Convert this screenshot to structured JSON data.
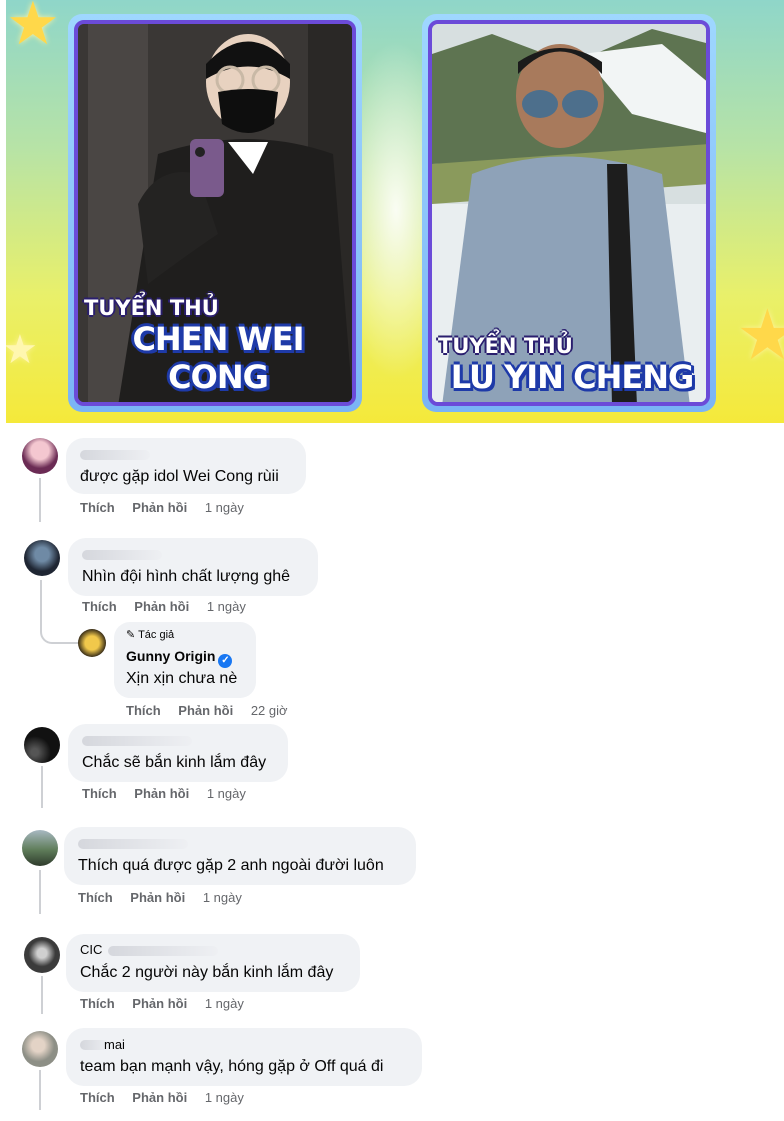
{
  "banner": {
    "card1": {
      "label_small": "TUYỂN THỦ",
      "label_big": "CHEN WEI CONG"
    },
    "card2": {
      "label_small": "TUYỂN THỦ",
      "label_big": "LU YIN CHENG"
    }
  },
  "comments": [
    {
      "name": "",
      "text": "được gặp idol Wei Cong rùii",
      "like": "Thích",
      "reply": "Phản hồi",
      "time": "1 ngày"
    },
    {
      "name": "",
      "text": "Nhìn đội hình chất lượng ghê",
      "like": "Thích",
      "reply": "Phản hồi",
      "time": "1 ngày",
      "reply_comment": {
        "tag": "Tác giả",
        "name": "Gunny Origin",
        "text": "Xịn xịn chưa nè",
        "like": "Thích",
        "reply": "Phản hồi",
        "time": "22 giờ"
      }
    },
    {
      "name": "",
      "text": "Chắc sẽ bắn kinh lắm đây",
      "like": "Thích",
      "reply": "Phản hồi",
      "time": "1 ngày"
    },
    {
      "name": "",
      "text": "Thích quá được gặp 2 anh ngoài đười luôn",
      "like": "Thích",
      "reply": "Phản hồi",
      "time": "1 ngày"
    },
    {
      "name": "CIC",
      "text": "Chắc 2 người này bắn kinh lắm đây",
      "like": "Thích",
      "reply": "Phản hồi",
      "time": "1 ngày"
    },
    {
      "name": "mai",
      "text": "team bạn mạnh vậy, hóng gặp ở Off quá đi",
      "like": "Thích",
      "reply": "Phản hồi",
      "time": "1 ngày"
    }
  ],
  "colors": {
    "bubble": "#f0f2f5",
    "action": "#65676b",
    "verified": "#1877f2",
    "card_border": "#6b4bd8"
  }
}
